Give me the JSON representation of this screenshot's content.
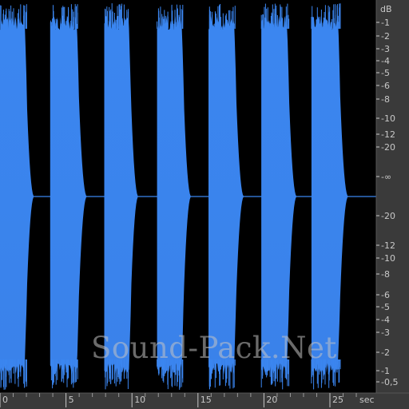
{
  "watermark": "Sound-Pack.Net",
  "colors": {
    "waveform": "#3b86f0",
    "waveform_bottom": "#3a82ea",
    "background": "#000000",
    "ruler": "#3a3a3a",
    "ruler_text": "#c8c8c8",
    "border": "#555555"
  },
  "db_scale": {
    "unit": "dB",
    "top_labels": [
      "-1",
      "-2",
      "-3",
      "-4",
      "-5",
      "-6",
      "-8",
      "-10",
      "-12",
      "-20",
      "-∞"
    ],
    "bottom_labels": [
      "-20",
      "-12",
      "-10",
      "-8",
      "-6",
      "-5",
      "-4",
      "-3",
      "-2",
      "-1",
      "-0,5"
    ]
  },
  "time_ruler": {
    "unit": "sec",
    "labels": [
      "0",
      "5",
      "10",
      "15",
      "20",
      "25"
    ],
    "max_seconds": 27.3
  },
  "waveform": {
    "bursts_seconds": [
      [
        0.0,
        2.6
      ],
      [
        3.8,
        6.6
      ],
      [
        7.9,
        10.5
      ],
      [
        11.9,
        14.5
      ],
      [
        15.8,
        18.5
      ],
      [
        19.8,
        22.5
      ],
      [
        23.6,
        26.4
      ]
    ]
  }
}
